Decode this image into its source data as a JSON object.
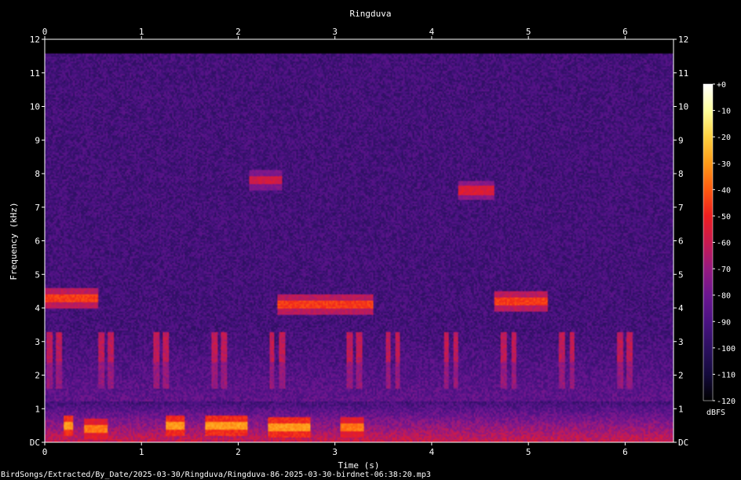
{
  "chart_data": {
    "type": "heatmap",
    "title": "Ringduva",
    "xlabel": "Time (s)",
    "ylabel": "Frequency (kHz)",
    "xlim": [
      0,
      6.5
    ],
    "ylim": [
      0,
      12
    ],
    "x_ticks": [
      "0",
      "1",
      "2",
      "3",
      "4",
      "5",
      "6"
    ],
    "y_ticks": [
      "DC",
      "1",
      "2",
      "3",
      "4",
      "5",
      "6",
      "7",
      "8",
      "9",
      "10",
      "11",
      "12"
    ],
    "colorbar": {
      "label": "dBFS",
      "range": [
        -120,
        0
      ],
      "ticks": [
        "+0",
        "-10",
        "-20",
        "-30",
        "-40",
        "-50",
        "-60",
        "-70",
        "-80",
        "-90",
        "-100",
        "-110",
        "-120"
      ],
      "colors": [
        "#000000",
        "#140a3c",
        "#2c1060",
        "#4a1282",
        "#6c1690",
        "#961a80",
        "#c81a50",
        "#ec1e20",
        "#ff5a10",
        "#ff9a18",
        "#ffd040",
        "#ffff9c",
        "#ffffff"
      ]
    },
    "signal_cutoff_khz": 11.6,
    "calls": [
      {
        "t_start": 0.0,
        "t_end": 0.55,
        "freq_khz": 4.3,
        "level_db": -45
      },
      {
        "t_start": 2.4,
        "t_end": 3.4,
        "freq_khz": 4.1,
        "level_db": -45
      },
      {
        "t_start": 4.65,
        "t_end": 5.2,
        "freq_khz": 4.2,
        "level_db": -45
      },
      {
        "t_start": 2.12,
        "t_end": 2.45,
        "freq_khz": 7.8,
        "level_db": -58
      },
      {
        "t_start": 4.28,
        "t_end": 4.65,
        "freq_khz": 7.5,
        "level_db": -55
      },
      {
        "t_start": 0.2,
        "t_end": 0.3,
        "freq_khz": 0.5,
        "level_db": -30
      },
      {
        "t_start": 0.4,
        "t_end": 0.65,
        "freq_khz": 0.4,
        "level_db": -35
      },
      {
        "t_start": 1.25,
        "t_end": 1.45,
        "freq_khz": 0.5,
        "level_db": -30
      },
      {
        "t_start": 1.65,
        "t_end": 2.1,
        "freq_khz": 0.5,
        "level_db": -30
      },
      {
        "t_start": 2.3,
        "t_end": 2.75,
        "freq_khz": 0.45,
        "level_db": -30
      },
      {
        "t_start": 3.05,
        "t_end": 3.3,
        "freq_khz": 0.45,
        "level_db": -35
      }
    ],
    "pulses_3khz": [
      0.05,
      0.15,
      0.58,
      0.68,
      1.15,
      1.25,
      1.75,
      1.85,
      2.35,
      2.45,
      3.15,
      3.25,
      3.55,
      3.65,
      4.15,
      4.25,
      4.75,
      4.85,
      5.35,
      5.45,
      5.95,
      6.05
    ],
    "status_text": "BirdSongs/Extracted/By_Date/2025-03-30/Ringduva/Ringduva-86-2025-03-30-birdnet-06:38:20.mp3"
  }
}
